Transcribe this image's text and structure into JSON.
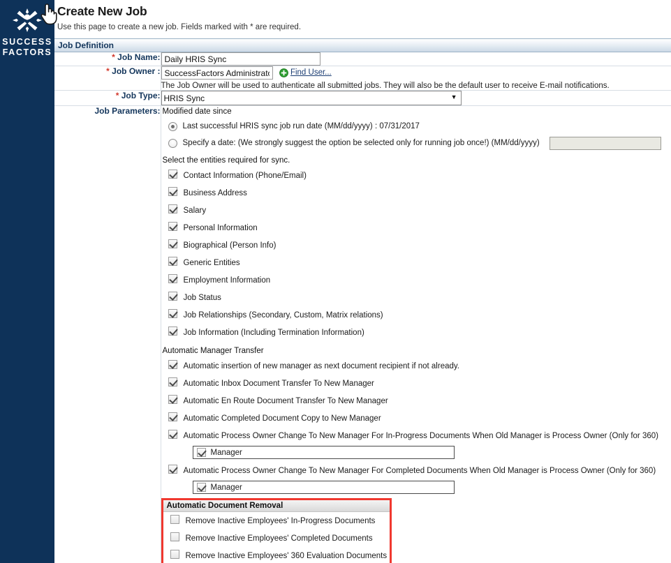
{
  "brand": {
    "line1": "SUCCESS",
    "line2": "FACTORS",
    "logo_icon": "successfactors-x-logo",
    "rail_color": "#0e3259"
  },
  "header": {
    "title": "Create New Job",
    "subtitle": "Use this page to create a new job. Fields marked with * are required."
  },
  "section": {
    "title": "Job Definition"
  },
  "fields": {
    "job_name": {
      "label": "Job Name:",
      "required_marker": "*",
      "value": "Daily HRIS Sync",
      "placeholder": ""
    },
    "job_owner": {
      "label": "Job Owner :",
      "required_marker": "*",
      "value": "SuccessFactors Administrator",
      "find_user_label": "Find User...",
      "find_user_icon": "green-plus-circle-icon",
      "help": "The Job Owner will be used to authenticate all submitted jobs. They will also be the default user to receive E-mail notifications."
    },
    "job_type": {
      "label": "Job Type:",
      "required_marker": "*",
      "selected": "HRIS Sync",
      "options": [
        "HRIS Sync"
      ],
      "chevron_icon": "chevron-down-icon"
    },
    "job_parameters": {
      "label": "Job Parameters:"
    }
  },
  "parameters": {
    "modified_date_heading": "Modified date since",
    "radio_options": [
      {
        "label": "Last successful HRIS sync job run date  (MM/dd/yyyy)   : 07/31/2017",
        "selected": true
      },
      {
        "label": "Specify a date: (We strongly suggest the option be selected only for running job once!)  (MM/dd/yyyy)",
        "selected": false,
        "date_value": "",
        "date_disabled": true
      }
    ],
    "entities_heading": "Select the entities required for sync.",
    "entities": [
      {
        "label": "Contact Information (Phone/Email)",
        "checked": true
      },
      {
        "label": "Business Address",
        "checked": true
      },
      {
        "label": "Salary",
        "checked": true
      },
      {
        "label": "Personal Information",
        "checked": true
      },
      {
        "label": "Biographical (Person Info)",
        "checked": true
      },
      {
        "label": "Generic Entities",
        "checked": true
      },
      {
        "label": "Employment Information",
        "checked": true
      },
      {
        "label": "Job Status",
        "checked": true
      },
      {
        "label": "Job Relationships (Secondary, Custom, Matrix relations)",
        "checked": true
      },
      {
        "label": "Job Information (Including Termination Information)",
        "checked": true
      }
    ],
    "manager_transfer_heading": "Automatic Manager Transfer",
    "manager_transfer": [
      {
        "label": "Automatic insertion of new manager as next document recipient if not already.",
        "checked": true
      },
      {
        "label": "Automatic Inbox Document Transfer To New Manager",
        "checked": true
      },
      {
        "label": "Automatic En Route Document Transfer To New Manager",
        "checked": true
      },
      {
        "label": "Automatic Completed Document Copy to New Manager",
        "checked": true
      },
      {
        "label": "Automatic Process Owner Change To New Manager For In-Progress Documents When Old Manager is Process Owner (Only for 360)",
        "checked": true,
        "sub": {
          "label": "Manager",
          "checked": true
        }
      },
      {
        "label": "Automatic Process Owner Change To New Manager For Completed Documents When Old Manager is Process Owner (Only for 360)",
        "checked": true,
        "sub": {
          "label": "Manager",
          "checked": true
        }
      }
    ],
    "document_removal": {
      "heading": "Automatic Document Removal",
      "highlight_color": "#f0382f",
      "items": [
        {
          "label": "Remove Inactive Employees' In-Progress Documents",
          "checked": false
        },
        {
          "label": "Remove Inactive Employees' Completed Documents",
          "checked": false
        },
        {
          "label": "Remove Inactive Employees' 360 Evaluation Documents",
          "checked": false
        }
      ]
    }
  },
  "cursor": {
    "icon": "pointing-hand-cursor"
  }
}
